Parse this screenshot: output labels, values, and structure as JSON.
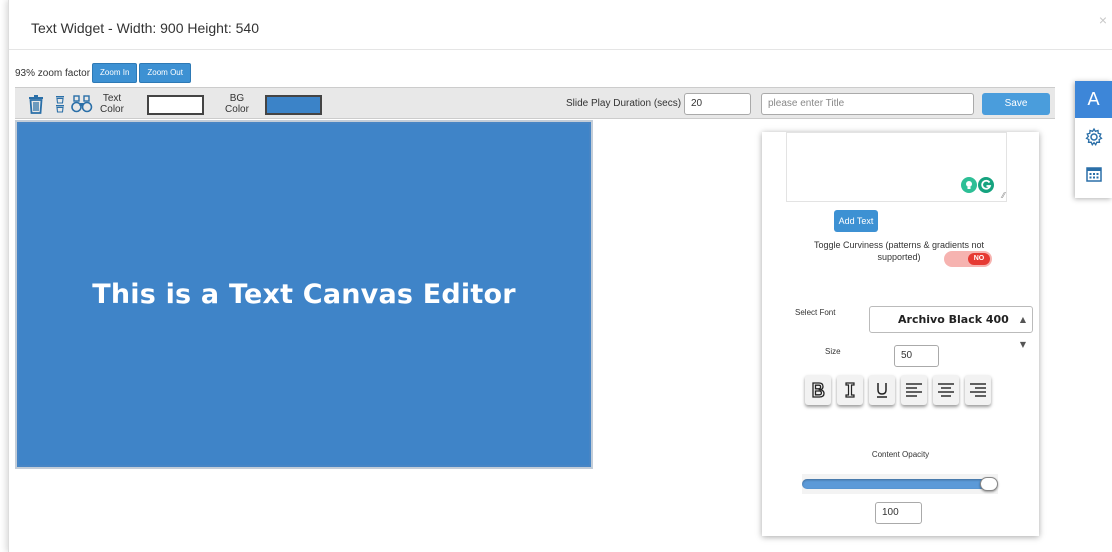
{
  "modal": {
    "title": "Text Widget - Width: 900 Height: 540",
    "close_label": "×"
  },
  "zoom": {
    "factor_label": "93% zoom factor",
    "zoom_in_label": "Zoom In",
    "zoom_out_label": "Zoom Out"
  },
  "toolbar": {
    "icons": [
      "trash-icon",
      "small-trash-icon",
      "binoculars-icon"
    ],
    "text_color_label_line1": "Text",
    "text_color_label_line2": "Color",
    "text_color_value": "#ffffff",
    "bg_color_label_line1": "BG",
    "bg_color_label_line2": "Color",
    "bg_color_value": "#3b83c8",
    "duration_label": "Slide Play Duration (secs)",
    "duration_value": "20",
    "title_placeholder": "please enter Title",
    "save_label": "Save"
  },
  "canvas": {
    "text": "This is a Text Canvas Editor",
    "background": "#3f84c8",
    "text_color": "#ffffff"
  },
  "panel": {
    "textarea_value": "",
    "add_text_label": "Add Text",
    "curviness_label": "Toggle Curviness (patterns & gradients not supported)",
    "toggle_value": "NO",
    "select_font_label": "Select Font",
    "font_value": "Archivo Black 400",
    "size_label": "Size",
    "size_value": "50",
    "format_buttons": [
      "bold-icon",
      "italic-icon",
      "underline-icon",
      "align-left-icon",
      "align-center-icon",
      "align-right-icon"
    ],
    "opacity_label": "Content Opacity",
    "opacity_value": "100",
    "opacity_fraction": 1.0
  },
  "sidebar": {
    "items": [
      "text-icon",
      "settings-gear-icon",
      "calendar-icon"
    ],
    "active_index": 0,
    "text_glyph": "A"
  },
  "colors": {
    "accent": "#3d91d3",
    "canvas_bg": "#3f84c8",
    "toggle_off": "#e63a33"
  }
}
